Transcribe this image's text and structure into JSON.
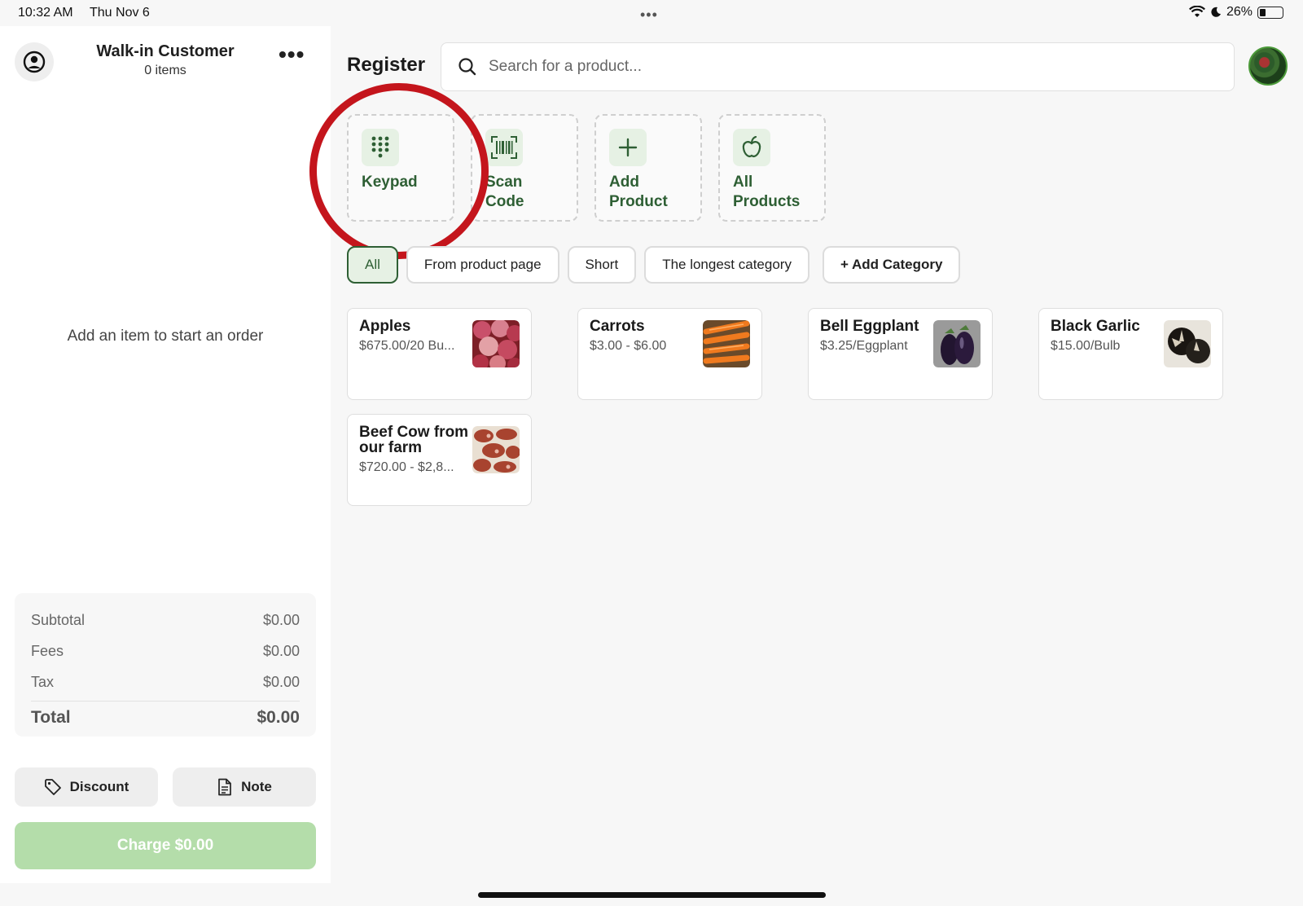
{
  "status_bar": {
    "time": "10:32 AM",
    "date": "Thu Nov 6",
    "battery": "26%"
  },
  "cart": {
    "customer_name": "Walk-in Customer",
    "item_count": "0 items",
    "empty_message": "Add an item to start an order",
    "totals": {
      "subtotal_label": "Subtotal",
      "subtotal_value": "$0.00",
      "fees_label": "Fees",
      "fees_value": "$0.00",
      "tax_label": "Tax",
      "tax_value": "$0.00",
      "total_label": "Total",
      "total_value": "$0.00"
    },
    "discount_label": "Discount",
    "note_label": "Note",
    "charge_label": "Charge $0.00"
  },
  "register": {
    "title": "Register",
    "search_placeholder": "Search for a product...",
    "actions": [
      {
        "label": "Keypad",
        "icon": "keypad-icon"
      },
      {
        "label": "Scan Code",
        "icon": "barcode-icon"
      },
      {
        "label": "Add Product",
        "icon": "plus-icon"
      },
      {
        "label": "All Products",
        "icon": "apple-icon"
      }
    ],
    "categories": [
      "All",
      "From product page",
      "Short",
      "The longest category"
    ],
    "active_category": "All",
    "add_category_label": "+ Add Category",
    "products": [
      {
        "name": "Apples",
        "price": "$675.00/20 Bu..."
      },
      {
        "name": "Carrots",
        "price": "$3.00 - $6.00"
      },
      {
        "name": "Bell Eggplant",
        "price": "$3.25/Eggplant"
      },
      {
        "name": "Black Garlic",
        "price": "$15.00/Bulb"
      },
      {
        "name": "Beef Cow from our farm",
        "price": "$720.00 - $2,8..."
      }
    ]
  },
  "colors": {
    "accent": "#2e5f34",
    "charge_disabled": "#b4ddaa",
    "annotation": "#c4151c"
  }
}
